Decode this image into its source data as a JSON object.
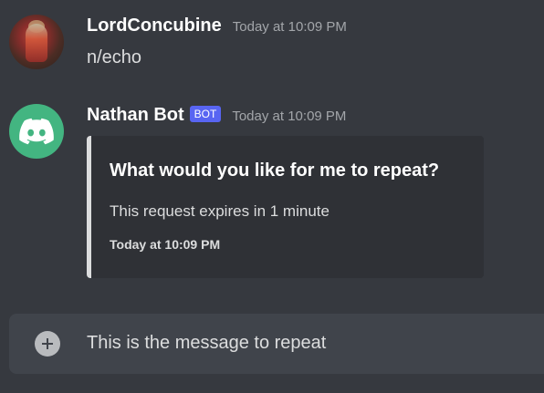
{
  "messages": [
    {
      "username": "LordConcubine",
      "timestamp": "Today at 10:09 PM",
      "content": "n/echo",
      "avatar_icon": "user-avatar"
    },
    {
      "username": "Nathan Bot",
      "bot_tag": "BOT",
      "timestamp": "Today at 10:09 PM",
      "avatar_icon": "discord-logo",
      "embed": {
        "title": "What would you like for me to repeat?",
        "description": "This request expires in 1 minute",
        "footer": "Today at 10:09 PM"
      }
    }
  ],
  "composer": {
    "value": "This is the message to repeat",
    "add_icon": "plus-circle-icon"
  },
  "colors": {
    "background": "#36393f",
    "embed_background": "#2f3136",
    "composer_background": "#40444b",
    "bot_tag": "#5865f2",
    "bot_avatar": "#43b581"
  }
}
